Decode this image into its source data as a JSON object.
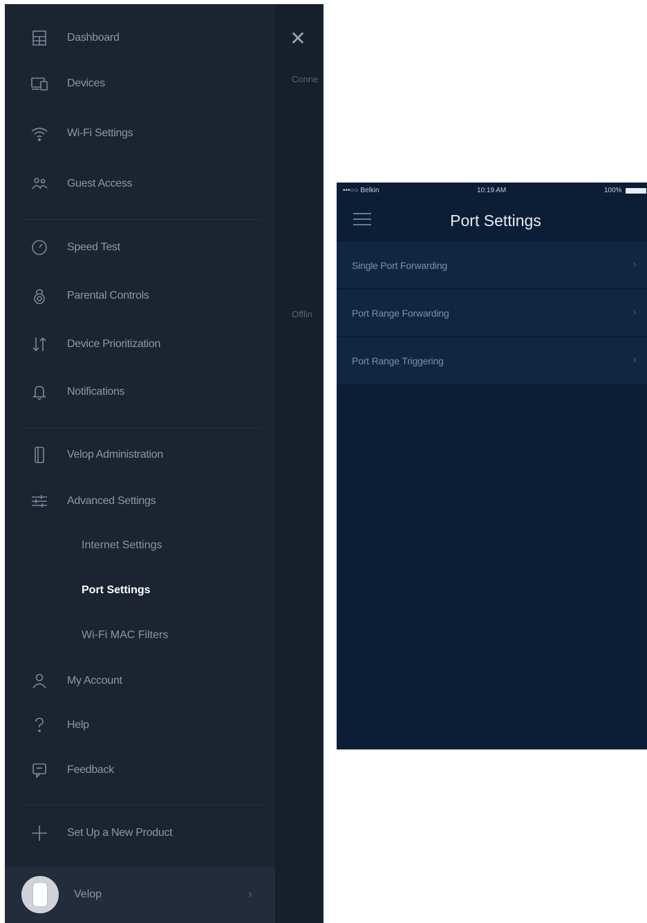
{
  "left_screen": {
    "close_icon": "close-icon",
    "behind_labels": [
      "Conne",
      "Offlin"
    ],
    "menu": {
      "items": [
        {
          "label": "Dashboard",
          "icon": "dashboard-icon"
        },
        {
          "label": "Devices",
          "icon": "devices-icon"
        },
        {
          "label": "Wi-Fi Settings",
          "icon": "wifi-icon"
        },
        {
          "label": "Guest Access",
          "icon": "guest-access-icon"
        },
        {
          "label": "Speed Test",
          "icon": "speedometer-icon"
        },
        {
          "label": "Parental Controls",
          "icon": "parental-controls-icon"
        },
        {
          "label": "Device Prioritization",
          "icon": "prioritization-arrows-icon"
        },
        {
          "label": "Notifications",
          "icon": "bell-icon"
        },
        {
          "label": "Velop Administration",
          "icon": "node-icon"
        },
        {
          "label": "Advanced Settings",
          "icon": "sliders-icon"
        },
        {
          "label": "My Account",
          "icon": "person-icon"
        },
        {
          "label": "Help",
          "icon": "question-icon"
        },
        {
          "label": "Feedback",
          "icon": "feedback-icon"
        },
        {
          "label": "Set Up a New Product",
          "icon": "plus-icon"
        }
      ],
      "advanced_sub_items": [
        {
          "label": "Internet Settings",
          "active": false
        },
        {
          "label": "Port Settings",
          "active": true
        },
        {
          "label": "Wi-Fi MAC Filters",
          "active": false
        }
      ]
    },
    "account": {
      "name": "Velop",
      "chevron": "›"
    }
  },
  "right_screen": {
    "status_bar": {
      "carrier": "•••○○ Belkin",
      "time": "10:19 AM",
      "battery": "100%"
    },
    "title": "Port Settings",
    "rows": [
      {
        "label": "Single Port Forwarding",
        "chevron": "›"
      },
      {
        "label": "Port Range Forwarding",
        "chevron": "›"
      },
      {
        "label": "Port Range Triggering",
        "chevron": "›"
      }
    ]
  },
  "colors": {
    "menu_bg": "#1c2431",
    "right_bg": "#0c1d36",
    "row_bg": "#102742",
    "active_text": "#ffffff",
    "inactive_text": "#8c96a4"
  }
}
